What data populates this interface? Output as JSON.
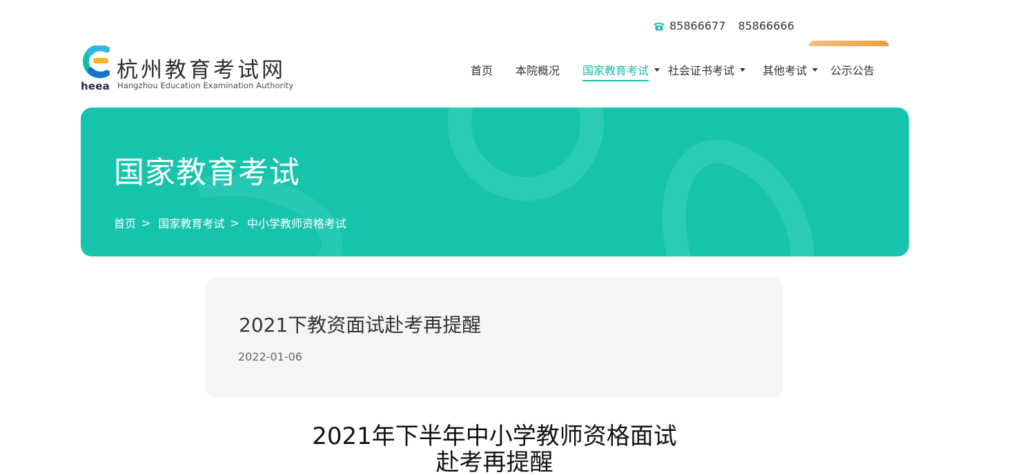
{
  "header": {
    "phone_numbers": [
      "85866677",
      "85866666"
    ],
    "logo": {
      "title": "杭州教育考试网",
      "subtitle": "Hangzhou Education Examination Authority",
      "abbr": "heea"
    },
    "nav": [
      {
        "label": "首页",
        "active": false,
        "dropdown": false
      },
      {
        "label": "本院概况",
        "active": false,
        "dropdown": false
      },
      {
        "label": "国家教育考试",
        "active": true,
        "dropdown": true
      },
      {
        "label": "社会证书考试",
        "active": false,
        "dropdown": true
      },
      {
        "label": "其他考试",
        "active": false,
        "dropdown": true
      },
      {
        "label": "公示公告",
        "active": false,
        "dropdown": false
      }
    ]
  },
  "banner": {
    "title": "国家教育考试",
    "breadcrumb": [
      "首页",
      "国家教育考试",
      "中小学教师资格考试"
    ],
    "separator": ">"
  },
  "article": {
    "title": "2021下教资面试赴考再提醒",
    "date": "2022-01-06",
    "content_heading_line1": "2021年下半年中小学教师资格面试",
    "content_heading_line2": "赴考再提醒"
  },
  "colors": {
    "brand": "#16c4ad",
    "accent_orange": "#ef9c3f"
  }
}
